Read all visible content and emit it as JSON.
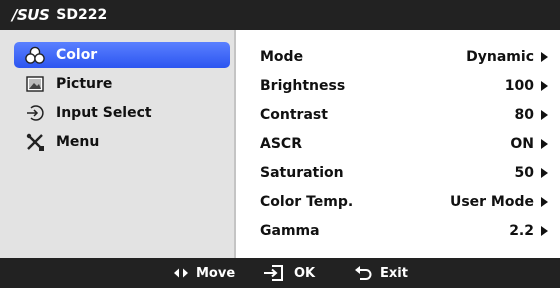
{
  "header": {
    "brand": "/SUS",
    "model": "SD222"
  },
  "sidebar": {
    "items": [
      {
        "label": "Color",
        "icon": "color-palette-icon",
        "active": true
      },
      {
        "label": "Picture",
        "icon": "picture-icon",
        "active": false
      },
      {
        "label": "Input Select",
        "icon": "input-select-icon",
        "active": false
      },
      {
        "label": "Menu",
        "icon": "tools-icon",
        "active": false
      }
    ]
  },
  "settings": [
    {
      "label": "Mode",
      "value": "Dynamic"
    },
    {
      "label": "Brightness",
      "value": "100"
    },
    {
      "label": "Contrast",
      "value": "80"
    },
    {
      "label": "ASCR",
      "value": "ON"
    },
    {
      "label": "Saturation",
      "value": "50"
    },
    {
      "label": "Color Temp.",
      "value": "User Mode"
    },
    {
      "label": "Gamma",
      "value": "2.2"
    }
  ],
  "footer": {
    "move": "Move",
    "ok": "OK",
    "exit": "Exit"
  },
  "colors": {
    "bar": "#222222",
    "sidebar": "#e3e3e3",
    "active": "#3a63f5",
    "content": "#ffffff"
  }
}
